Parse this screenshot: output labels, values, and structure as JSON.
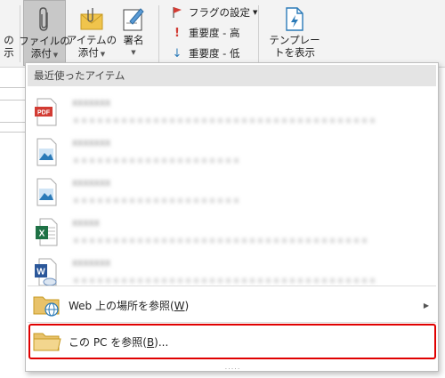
{
  "ribbon": {
    "attach_file": {
      "line1": "ファイルの",
      "line2": "添付"
    },
    "attach_item": {
      "line1": "アイテムの",
      "line2": "添付"
    },
    "signature": {
      "label": "署名"
    },
    "left_partial": {
      "line1": "の",
      "line2": "示"
    },
    "follow_up": "フラグの設定",
    "importance_high": "重要度 - 高",
    "importance_low": "重要度 - 低",
    "templates": {
      "line1": "テンプレー",
      "line2": "トを表示"
    }
  },
  "menu": {
    "header": "最近使ったアイテム",
    "recent_items": [
      {
        "type": "pdf",
        "name": "XXXXXXX",
        "path": "ｘｘｘｘｘｘｘｘｘｘｘｘｘｘｘｘｘｘｘｘｘｘｘｘｘｘｘｘｘｘｘｘｘｘｘｘｘｘ"
      },
      {
        "type": "image",
        "name": "XXXXXXX",
        "path": "ｘｘｘｘｘｘｘｘｘｘｘｘｘｘｘｘｘｘｘｘｘ"
      },
      {
        "type": "image",
        "name": "XXXXXXX",
        "path": "ｘｘｘｘｘｘｘｘｘｘｘｘｘｘｘｘｘｘｘｘｘ"
      },
      {
        "type": "excel",
        "name": "XXXXX",
        "path": "ｘｘｘｘｘｘｘｘｘｘｘｘｘｘｘｘｘｘｘｘｘｘｘｘｘｘｘｘｘｘｘｘｘｘｘｘｘ"
      },
      {
        "type": "word",
        "name": "XXXXXXX",
        "path": "ｘｘｘｘｘｘｘｘｘｘｘｘｘｘｘｘｘｘｘｘｘｘｘｘｘｘｘｘｘｘｘｘｘｘｘｘｘｘ"
      }
    ],
    "browse_web": {
      "prefix": "Web 上の場所を参照(",
      "key": "W",
      "suffix": ")"
    },
    "browse_pc": {
      "prefix": "この PC を参照(",
      "key": "B",
      "suffix": ")..."
    },
    "grip": "....."
  },
  "colors": {
    "pdf": "#d23b33",
    "excel": "#1e7145",
    "word": "#2b579a",
    "image": "#2a7ab8",
    "highlight": "#e00000",
    "folder": "#e8c26a"
  }
}
